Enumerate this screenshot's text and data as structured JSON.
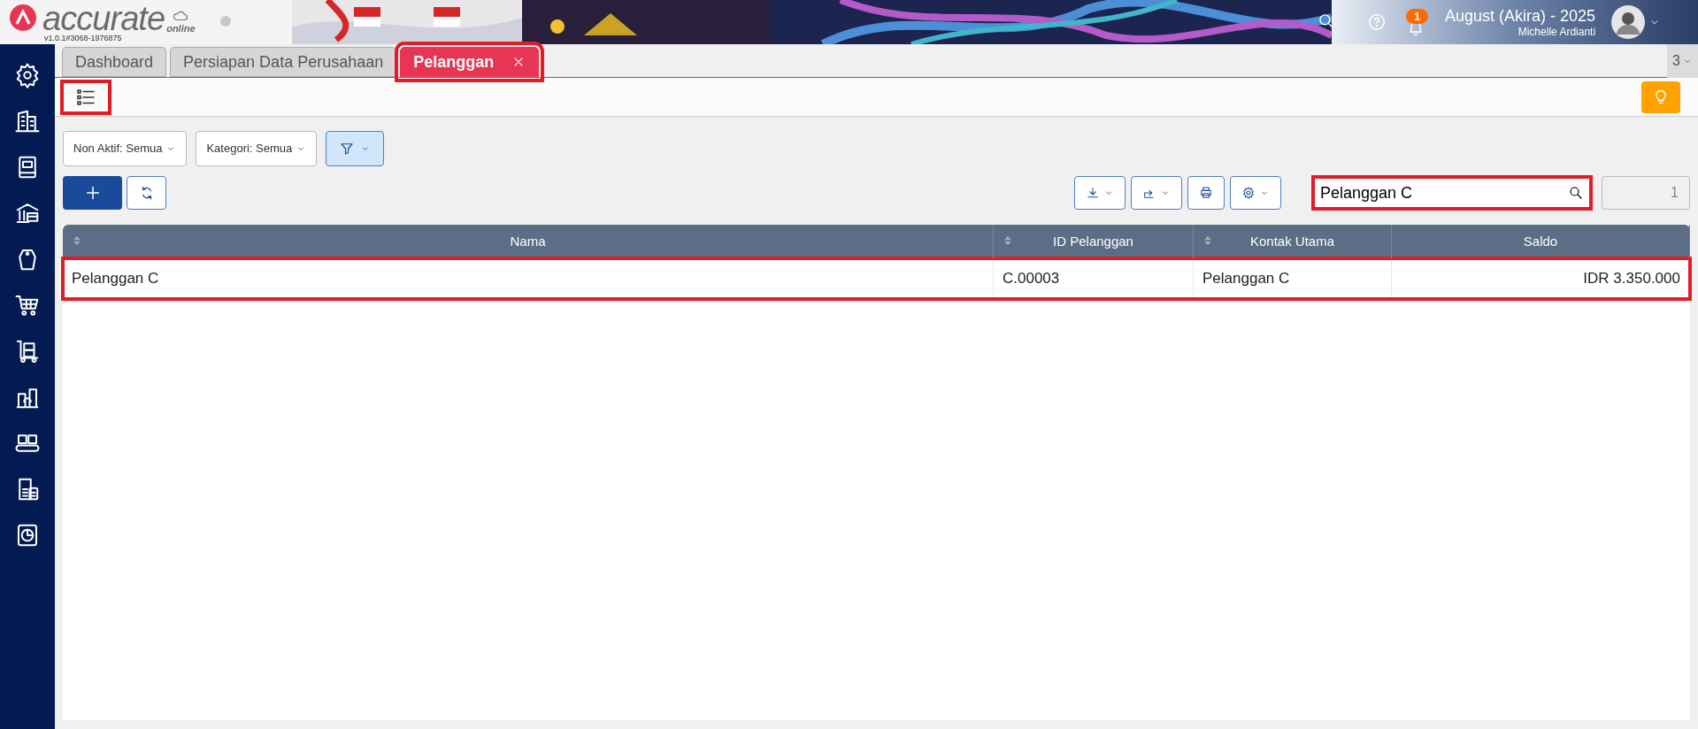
{
  "app": {
    "logo": "accurate",
    "logo_sub": "online",
    "version": "v1.0.1#3068-1976875"
  },
  "header": {
    "notifications": "1",
    "period": "August (Akira) - 2025",
    "user": "Michelle Ardianti"
  },
  "tabs": [
    {
      "label": "Dashboard",
      "selected": false,
      "closable": false,
      "highlighted": false
    },
    {
      "label": "Persiapan Data Perusahaan",
      "selected": false,
      "closable": false,
      "highlighted": false
    },
    {
      "label": "Pelanggan",
      "selected": true,
      "closable": true,
      "highlighted": true
    }
  ],
  "tab_count": "3",
  "toolbar": {
    "list_button_highlighted": true
  },
  "filters": [
    {
      "label": "Non Aktif: Semua"
    },
    {
      "label": "Kategori: Semua"
    }
  ],
  "search": {
    "value": "Pelanggan C",
    "highlighted": true
  },
  "page_number": "1",
  "table": {
    "columns": [
      {
        "label": "Nama",
        "sortable": true
      },
      {
        "label": "ID Pelanggan",
        "sortable": true
      },
      {
        "label": "Kontak Utama",
        "sortable": true
      },
      {
        "label": "Saldo",
        "sortable": false
      }
    ],
    "rows": [
      {
        "cells": [
          "Pelanggan C",
          "C.00003",
          "Pelanggan C",
          "IDR 3.350.000"
        ],
        "highlighted": true
      }
    ]
  }
}
